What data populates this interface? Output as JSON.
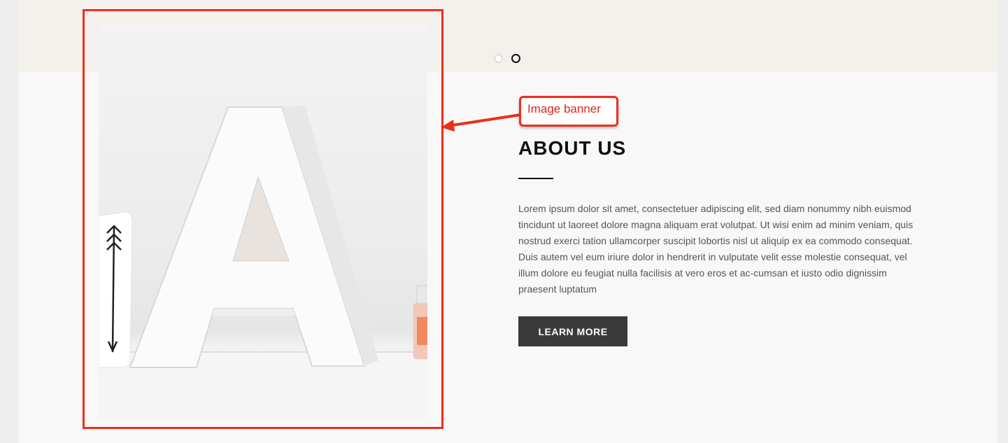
{
  "slider": {
    "dot_count": 2,
    "active_index": 1
  },
  "annotation": {
    "callout_label": "Image banner",
    "color": "#ee2e1c"
  },
  "about": {
    "title": "ABOUT US",
    "body": "Lorem ipsum dolor sit amet, consectetuer adipiscing elit, sed diam nonummy nibh euismod tincidunt ut laoreet dolore magna aliquam erat volutpat. Ut wisi enim ad minim veniam, quis nostrud exerci tation ullamcorper suscipit lobortis nisl ut aliquip ex ea commodo consequat. Duis autem vel eum iriure dolor in hendrerit in vulputate velit esse molestie consequat, vel illum dolore eu feugiat nulla facilisis at vero eros et ac-cumsan et iusto odio dignissim praesent luptatum",
    "button_label": "LEARN MORE"
  },
  "colors": {
    "background": "#f8f8f8",
    "top_band": "#f4f0eb",
    "button": "#3a3a3a",
    "title": "#111111"
  },
  "image_banner": {
    "subject": "white letter A decoration with mug and jar"
  }
}
